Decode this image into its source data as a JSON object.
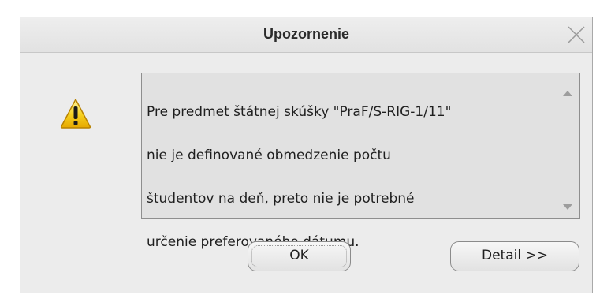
{
  "dialog": {
    "title": "Upozornenie",
    "close_icon": "close-x-icon",
    "warning_icon": "warning-triangle-icon",
    "message_lines": [
      "Pre predmet štátnej skúšky \"PraF/S-RIG-1/11\"",
      "nie je definované obmedzenie počtu",
      "študentov na deň, preto nie je potrebné",
      "určenie preferovaného dátumu."
    ],
    "buttons": {
      "ok_label": "OK",
      "detail_label": "Detail >>"
    }
  }
}
